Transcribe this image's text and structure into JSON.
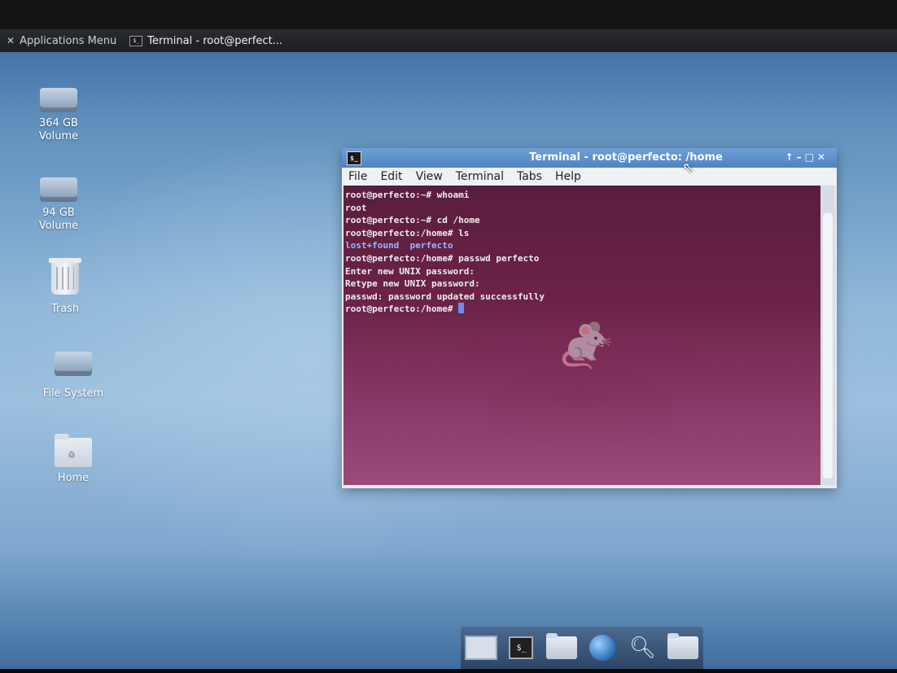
{
  "panel": {
    "apps_menu_label": "Applications Menu",
    "taskbar_item_label": "Terminal - root@perfect..."
  },
  "desktop_icons": [
    {
      "line1": "364 GB",
      "line2": "Volume"
    },
    {
      "line1": "94 GB",
      "line2": "Volume"
    },
    {
      "line1": "Trash"
    },
    {
      "line1": "File System"
    },
    {
      "line1": "Home"
    }
  ],
  "terminal": {
    "title": "Terminal - root@perfecto: /home",
    "menu": [
      "File",
      "Edit",
      "View",
      "Terminal",
      "Tabs",
      "Help"
    ],
    "lines": [
      "root@perfecto:~# whoami",
      "root",
      "root@perfecto:~# cd /home",
      "root@perfecto:/home# ls",
      "lost+found  perfecto",
      "root@perfecto:/home# passwd perfecto",
      "Enter new UNIX password:",
      "Retype new UNIX password:",
      "passwd: password updated successfully",
      "root@perfecto:/home# "
    ]
  },
  "icons": {
    "title_icon": "terminal-icon",
    "controls": [
      "pin-icon",
      "minimize-icon",
      "maximize-icon",
      "close-icon"
    ],
    "dock": [
      "show-desktop-icon",
      "terminal-icon",
      "home-folder-icon",
      "web-browser-icon",
      "search-icon",
      "folder-icon"
    ]
  },
  "colors": {
    "title_bar": "#5b8fcf",
    "terminal_bg": "#6c2348",
    "desktop_bg": "#8fb7d8"
  }
}
